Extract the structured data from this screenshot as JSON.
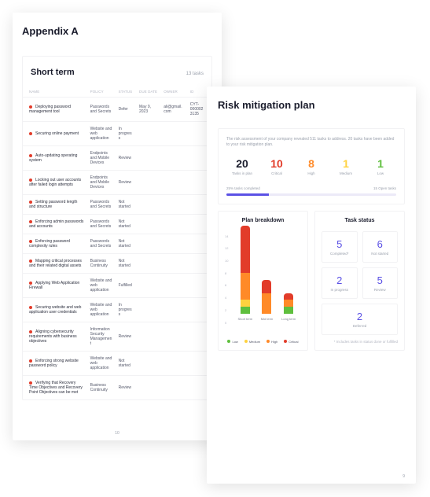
{
  "back": {
    "title": "Appendix A",
    "section_title": "Short term",
    "task_count": "13 tasks",
    "page_num": "10",
    "columns": {
      "name": "NAME",
      "policy": "POLICY",
      "status": "STATUS",
      "due": "DUE DATE",
      "owner": "OWNER",
      "id": "ID"
    },
    "tasks": [
      {
        "name": "Deploying password management tool",
        "policy": "Passwords and Secrets",
        "status": "Defer",
        "due": "May 9, 2023",
        "owner": "ali@gmail.com",
        "id": "CYT-0000023135"
      },
      {
        "name": "Securing online payment",
        "policy": "Website and web application",
        "status": "In progress"
      },
      {
        "name": "Auto-updating operating system",
        "policy": "Endpoints and Mobile Devices",
        "status": "Review"
      },
      {
        "name": "Locking out user accounts after failed login attempts",
        "policy": "Endpoints and Mobile Devices",
        "status": "Review"
      },
      {
        "name": "Setting password length and structure",
        "policy": "Passwords and Secrets",
        "status": "Not started"
      },
      {
        "name": "Enforcing admin passwords and accounts",
        "policy": "Passwords and Secrets",
        "status": "Not started"
      },
      {
        "name": "Enforcing password complexity rules",
        "policy": "Passwords and Secrets",
        "status": "Not started"
      },
      {
        "name": "Mapping critical processes and their related digital assets",
        "policy": "Business Continuity",
        "status": "Not started"
      },
      {
        "name": "Applying Web Application Firewall",
        "policy": "Website and web application",
        "status": "Fulfilled"
      },
      {
        "name": "Securing website and web application user credentials",
        "policy": "Website and web application",
        "status": "In progress"
      },
      {
        "name": "Aligning cybersecurity requirements with business objectives",
        "policy": "Information Security Management",
        "status": "Review"
      },
      {
        "name": "Enforcing strong website password policy",
        "policy": "Website and web application",
        "status": "Not started"
      },
      {
        "name": "Verifying that Recovery Time Objectives and Recovery Point Objectives can be met",
        "policy": "Business Continuity",
        "status": "Review"
      }
    ]
  },
  "front": {
    "title": "Risk mitigation plan",
    "intro": "The risk assessment of your company revealed 511 tasks to address. 20 tasks have been added to your risk mitigation plan.",
    "page_num": "9",
    "stats": [
      {
        "num": "20",
        "label": "Tasks in plan",
        "color": "#1a1c2c"
      },
      {
        "num": "10",
        "label": "Critical",
        "color": "#e23c2a"
      },
      {
        "num": "8",
        "label": "High",
        "color": "#ff8a28"
      },
      {
        "num": "1",
        "label": "Medium",
        "color": "#ffd23f"
      },
      {
        "num": "1",
        "label": "Low",
        "color": "#5fbf3e"
      }
    ],
    "progress": {
      "pct": "25% tasks completed",
      "open": "15 Open tasks",
      "fillPct": 25
    },
    "breakdown": {
      "title": "Plan breakdown",
      "ticks": [
        "14",
        "12",
        "10",
        "8",
        "6",
        "4",
        "2",
        "0"
      ],
      "categories": [
        "Short term",
        "Mid term",
        "Long term"
      ],
      "legend": [
        {
          "label": "Low",
          "color": "#5fbf3e"
        },
        {
          "label": "Medium",
          "color": "#ffd23f"
        },
        {
          "label": "High",
          "color": "#ff8a28"
        },
        {
          "label": "Critical",
          "color": "#e23c2a"
        }
      ]
    },
    "task_status": {
      "title": "Task status",
      "tiles": [
        {
          "num": "5",
          "label": "Completed*",
          "color": "#5b51e5"
        },
        {
          "num": "6",
          "label": "Not started",
          "color": "#5b51e5"
        },
        {
          "num": "2",
          "label": "In progress",
          "color": "#5b51e5"
        },
        {
          "num": "5",
          "label": "Review",
          "color": "#5b51e5"
        },
        {
          "num": "2",
          "label": "Deferred",
          "color": "#5b51e5",
          "full": true
        }
      ],
      "footnote": "* Includes tasks in status done or fulfilled"
    }
  },
  "chart_data": {
    "type": "bar",
    "title": "Plan breakdown",
    "xlabel": "",
    "ylabel": "",
    "ylim": [
      0,
      14
    ],
    "categories": [
      "Short term",
      "Mid term",
      "Long term"
    ],
    "series": [
      {
        "name": "Low",
        "values": [
          1,
          0,
          1
        ]
      },
      {
        "name": "Medium",
        "values": [
          1,
          0,
          0
        ]
      },
      {
        "name": "High",
        "values": [
          4,
          3,
          1
        ]
      },
      {
        "name": "Critical",
        "values": [
          7,
          2,
          1
        ]
      }
    ]
  }
}
